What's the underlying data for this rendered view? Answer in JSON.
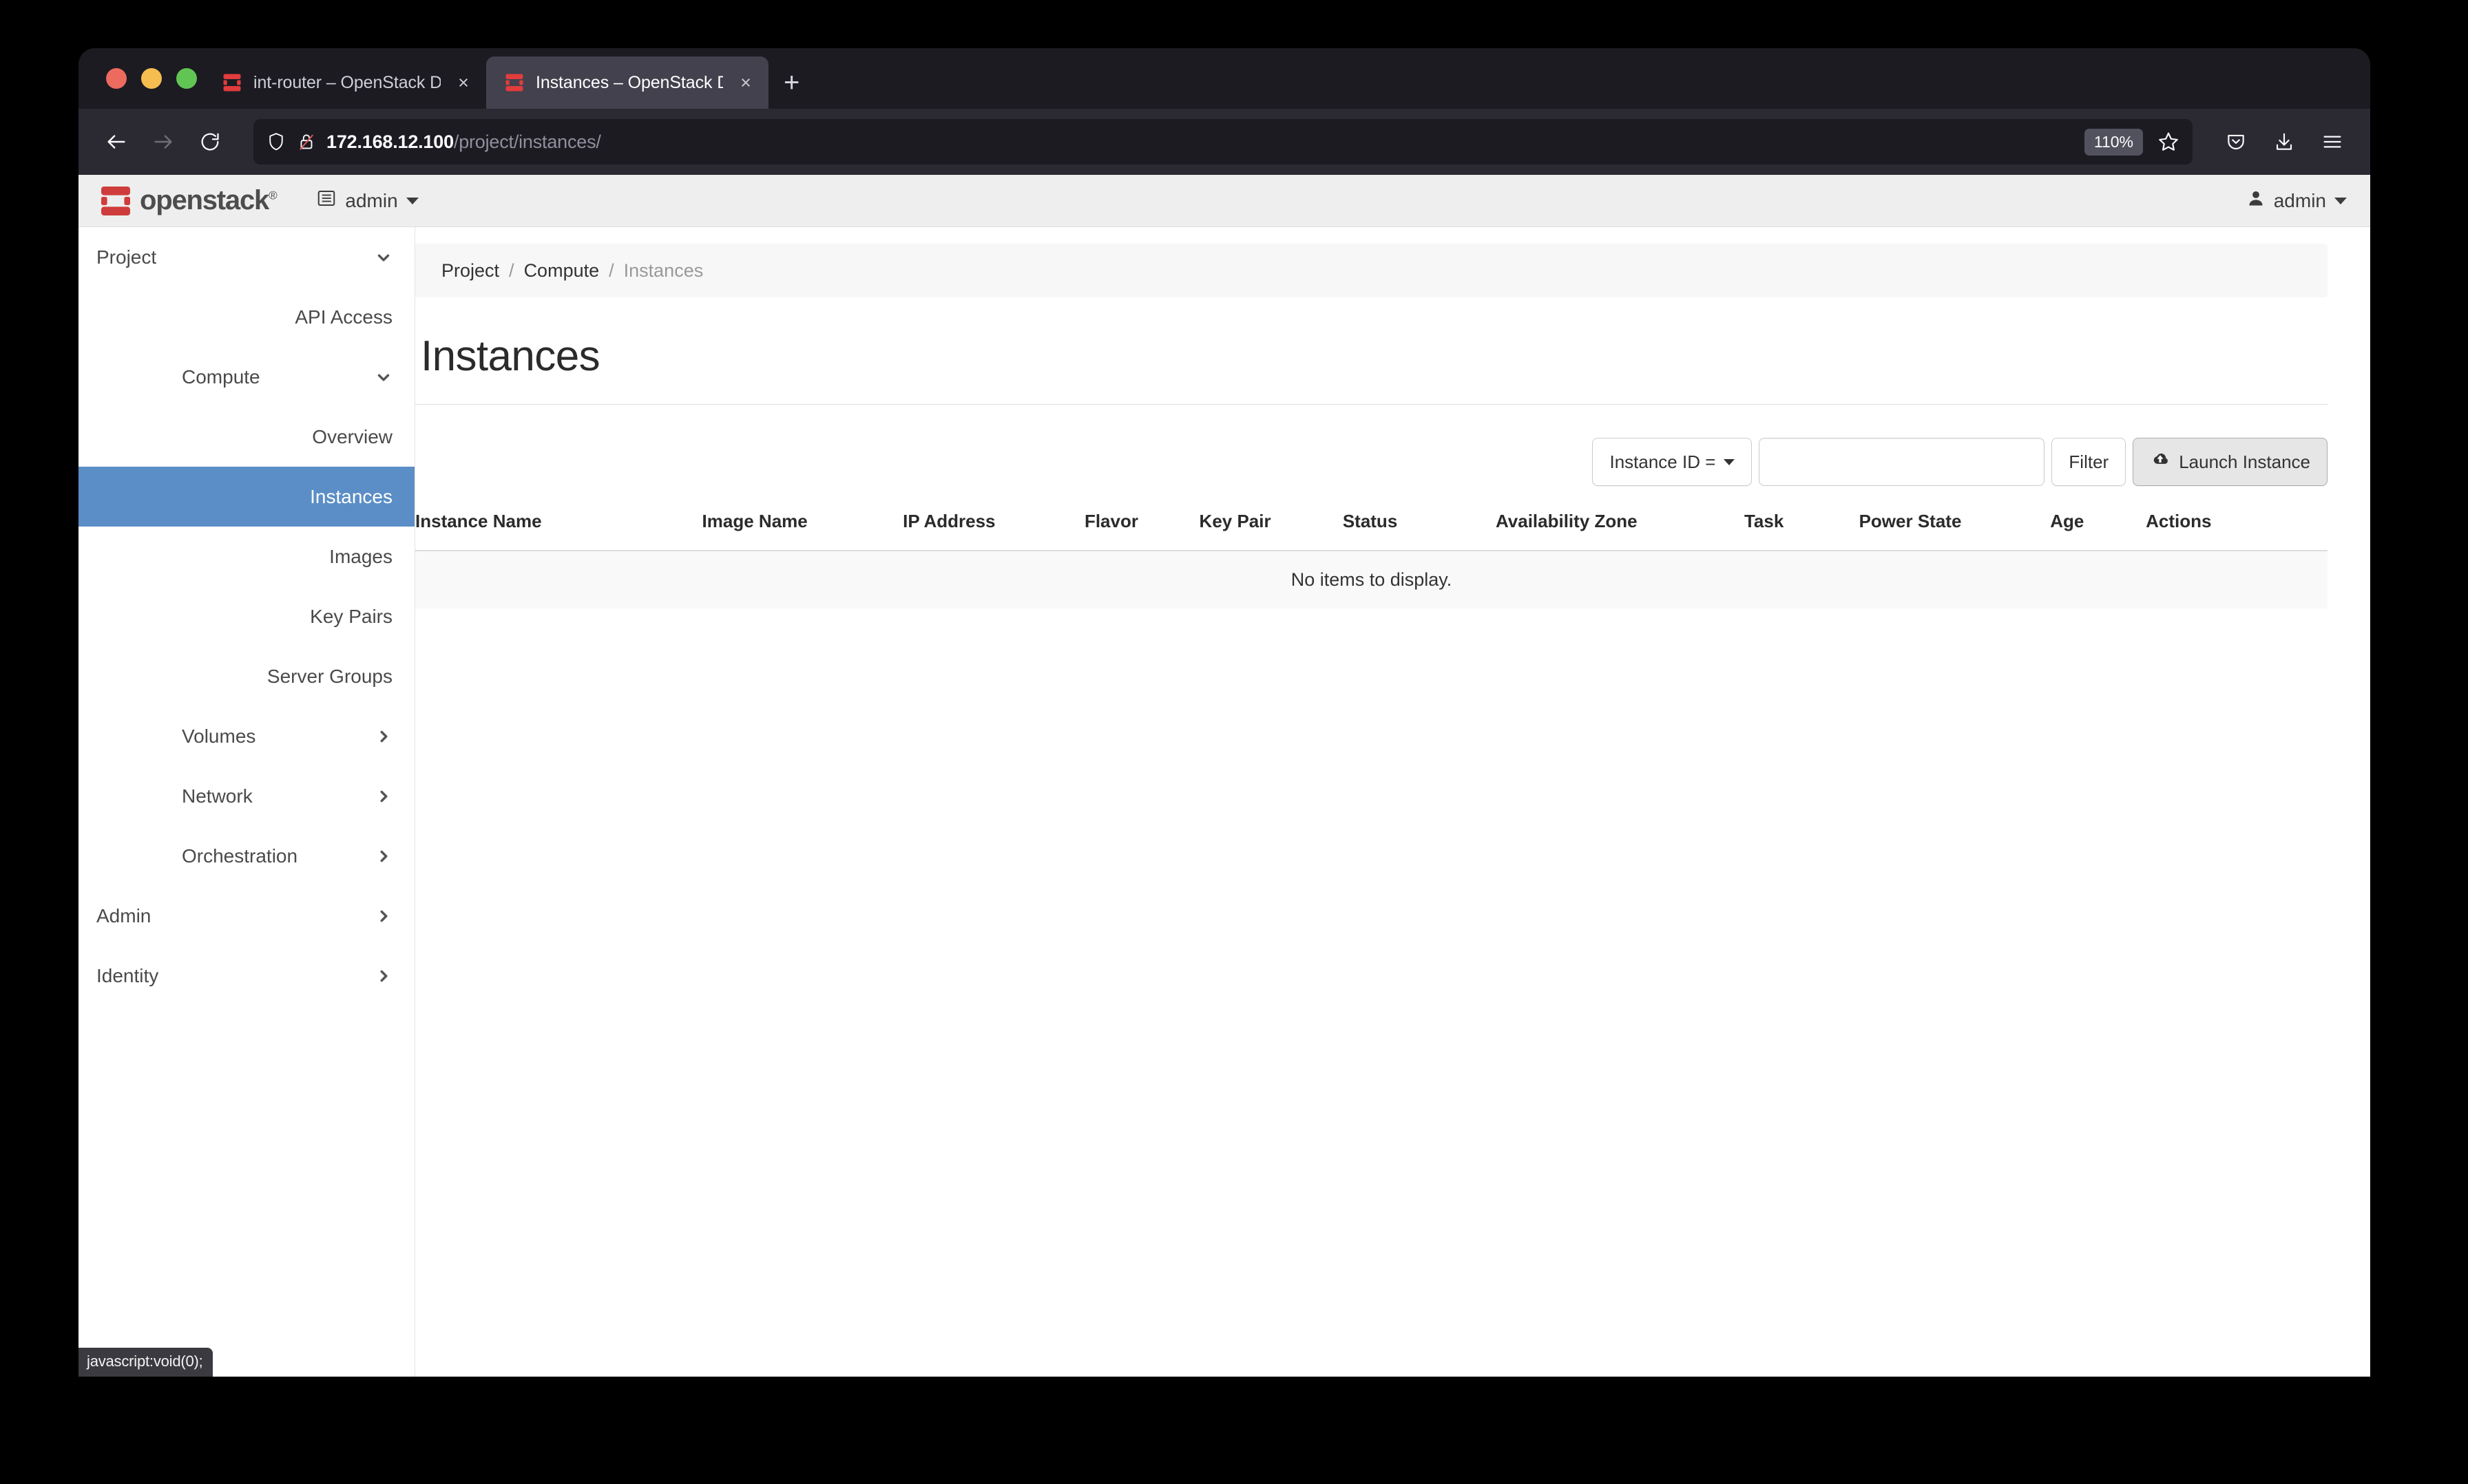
{
  "browser": {
    "tabs": [
      {
        "title": "int-router – OpenStack Dashboa",
        "favicon": "openstack-favicon",
        "active": false,
        "close_label": "×"
      },
      {
        "title": "Instances – OpenStack Dashboa",
        "favicon": "openstack-favicon",
        "active": true,
        "close_label": "×"
      }
    ],
    "new_tab_label": "+",
    "back_icon": "back-arrow-icon",
    "forward_icon": "forward-arrow-icon",
    "reload_icon": "reload-icon",
    "url_host": "172.168.12.100",
    "url_path": "/project/instances/",
    "shield_icon": "shield-icon",
    "insecure_icon": "lock-crossed-icon",
    "zoom_level": "110%",
    "bookmark_icon": "star-icon",
    "pocket_icon": "pocket-icon",
    "downloads_icon": "download-icon",
    "menu_icon": "hamburger-menu-icon"
  },
  "topbar": {
    "brand": "openstack",
    "brand_mark": "openstack-logo-icon",
    "brand_registered": "®",
    "project_icon": "list-icon",
    "project_name": "admin",
    "user_icon": "user-icon",
    "user_name": "admin"
  },
  "sidebar": {
    "items": [
      {
        "label": "Project",
        "level": 0,
        "icon": "chevron-down-icon",
        "active": false
      },
      {
        "label": "API Access",
        "level": 2,
        "icon": "",
        "active": false
      },
      {
        "label": "Compute",
        "level": 1,
        "icon": "chevron-down-icon",
        "active": false
      },
      {
        "label": "Overview",
        "level": 2,
        "icon": "",
        "active": false
      },
      {
        "label": "Instances",
        "level": 2,
        "icon": "",
        "active": true
      },
      {
        "label": "Images",
        "level": 2,
        "icon": "",
        "active": false
      },
      {
        "label": "Key Pairs",
        "level": 2,
        "icon": "",
        "active": false
      },
      {
        "label": "Server Groups",
        "level": 2,
        "icon": "",
        "active": false
      },
      {
        "label": "Volumes",
        "level": 1,
        "icon": "chevron-right-icon",
        "active": false
      },
      {
        "label": "Network",
        "level": 1,
        "icon": "chevron-right-icon",
        "active": false
      },
      {
        "label": "Orchestration",
        "level": 1,
        "icon": "chevron-right-icon",
        "active": false
      },
      {
        "label": "Admin",
        "level": 0,
        "icon": "chevron-right-icon",
        "active": false
      },
      {
        "label": "Identity",
        "level": 0,
        "icon": "chevron-right-icon",
        "active": false
      }
    ]
  },
  "main": {
    "breadcrumb": [
      "Project",
      "Compute",
      "Instances"
    ],
    "breadcrumb_separator": "/",
    "title": "Instances",
    "filter": {
      "field_label": "Instance ID =",
      "input_value": "",
      "input_placeholder": "",
      "filter_button": "Filter",
      "launch_button": "Launch Instance",
      "launch_icon": "cloud-upload-icon"
    },
    "table": {
      "columns": [
        "Instance Name",
        "Image Name",
        "IP Address",
        "Flavor",
        "Key Pair",
        "Status",
        "Availability Zone",
        "Task",
        "Power State",
        "Age",
        "Actions"
      ],
      "rows": [],
      "empty_message": "No items to display."
    }
  },
  "status_bar": {
    "text": "javascript:void(0);"
  },
  "colors": {
    "accent_blue": "#5b8ec6",
    "brand_red": "#cf3c3c",
    "chrome_dark": "#1c1b22",
    "chrome_nav": "#2b2a33",
    "tab_active": "#42414d"
  }
}
